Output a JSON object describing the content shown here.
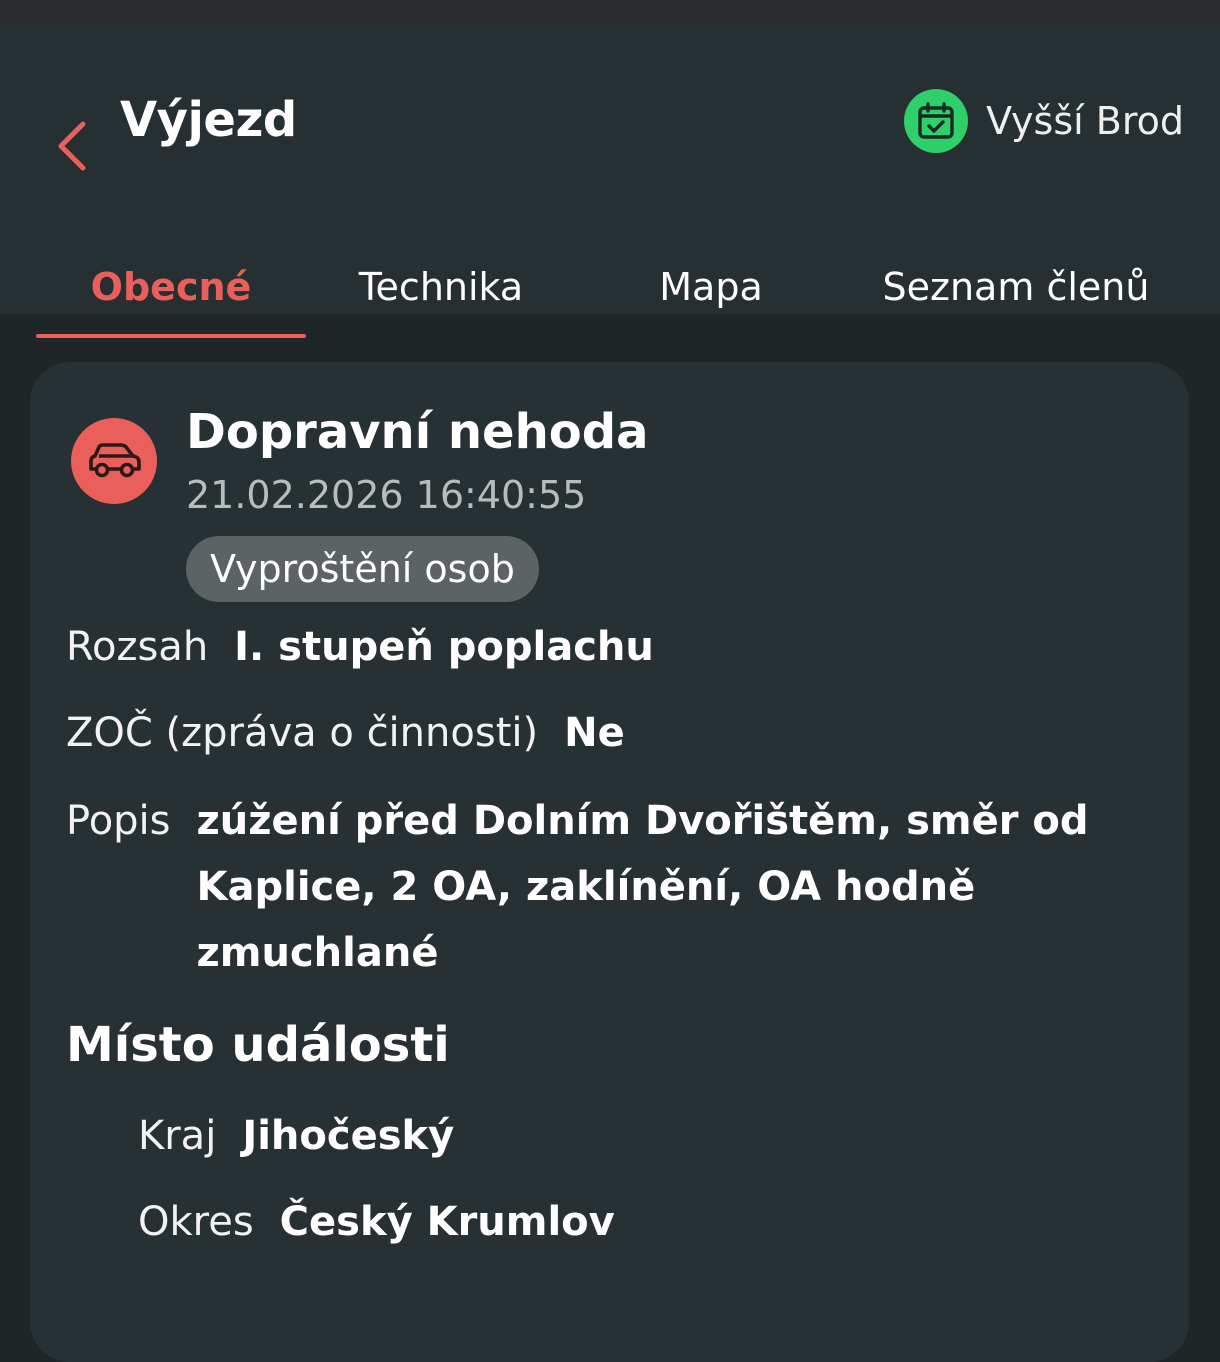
{
  "colors": {
    "accent": "#ea5f5a",
    "station_green": "#2fcf6a",
    "header_bg": "#263033",
    "page_bg": "#1f2628",
    "card_bg": "#273133",
    "chip_bg": "#5c6365",
    "muted_text": "#b7bcbd"
  },
  "header": {
    "back_icon": "chevron-left-icon",
    "title": "Výjezd",
    "station_icon": "calendar-check-icon",
    "station_name": "Vyšší Brod"
  },
  "tabs": [
    {
      "label": "Obecné",
      "active": true
    },
    {
      "label": "Technika",
      "active": false
    },
    {
      "label": "Mapa",
      "active": false
    },
    {
      "label": "Seznam členů",
      "active": false
    }
  ],
  "event": {
    "type_icon": "car-icon",
    "title": "Dopravní nehoda",
    "datetime": "21.02.2026 16:40:55",
    "subtype": "Vyproštění osob",
    "rozsah_label": "Rozsah",
    "rozsah_value": "I. stupeň poplachu",
    "zoc_label": "ZOČ (zpráva o činnosti)",
    "zoc_value": "Ne",
    "popis_label": "Popis",
    "popis_value": "zúžení před Dolním Dvořištěm, směr od Kaplice, 2 OA, zaklínění, OA hodně zmuchlané"
  },
  "location": {
    "section_title": "Místo události",
    "kraj_label": "Kraj",
    "kraj_value": "Jihočeský",
    "okres_label": "Okres",
    "okres_value": "Český Krumlov"
  }
}
